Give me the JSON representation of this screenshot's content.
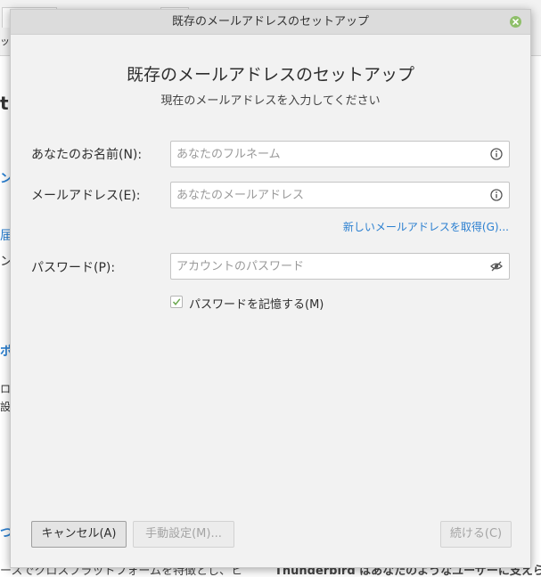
{
  "background": {
    "fragments": [
      "ット",
      "t",
      "ン",
      "届",
      "ン",
      "ポ",
      "ロ",
      "設",
      "つ"
    ],
    "footer_left": "ースでクロスプラットフォームを特徴とし、ヒ",
    "footer_right": "Thunderbird はあなたのようなユーザーに支えられ"
  },
  "dialog": {
    "window_title": "既存のメールアドレスのセットアップ",
    "heading": "既存のメールアドレスのセットアップ",
    "subheading": "現在のメールアドレスを入力してください",
    "name": {
      "label": "あなたのお名前(N):",
      "placeholder": "あなたのフルネーム",
      "value": ""
    },
    "email": {
      "label": "メールアドレス(E):",
      "placeholder": "あなたのメールアドレス",
      "value": ""
    },
    "get_new_link": "新しいメールアドレスを取得(G)...",
    "password": {
      "label": "パスワード(P):",
      "placeholder": "アカウントのパスワード",
      "value": ""
    },
    "remember_password": {
      "label": "パスワードを記憶する(M)",
      "checked": true
    },
    "buttons": {
      "cancel": "キャンセル(A)",
      "manual": "手動設定(M)...",
      "continue": "続ける(C)"
    }
  },
  "colors": {
    "accent_link": "#2a7fd0",
    "close_button": "#8fbf6a",
    "check_mark": "#6aa84f"
  },
  "icons": {
    "name_info": "info-icon",
    "email_info": "info-icon",
    "password_toggle": "eye-slash-icon",
    "close": "close-icon",
    "check": "check-icon"
  }
}
